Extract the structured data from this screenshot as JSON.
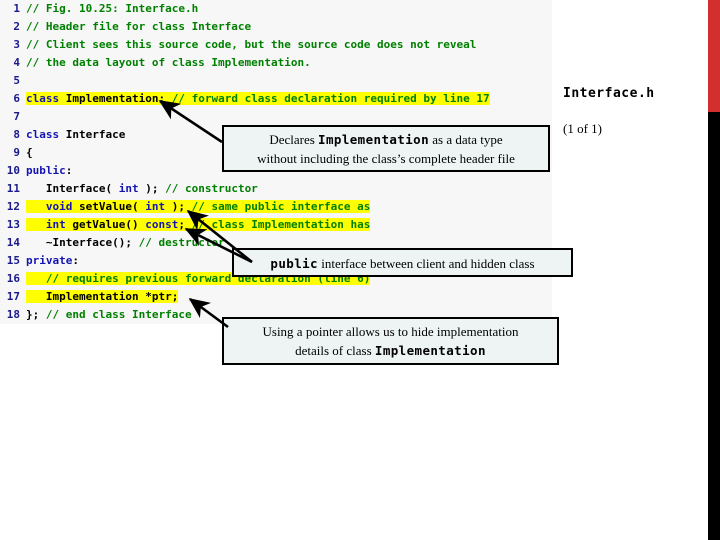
{
  "slide": {
    "file_title": "Interface.h",
    "page_indicator": "(1 of 1)",
    "accent_color": "#d32f2f",
    "highlight_color": "#ffff00",
    "comment_color": "#008000",
    "keyword_color": "#1414b4",
    "callout_fill": "#eef4f4",
    "code_panel_fill": "#f7f7f7"
  },
  "code": {
    "lines": [
      {
        "n": "1",
        "highlight": false,
        "tokens": [
          {
            "t": "c",
            "s": "// Fig. 10.25: Interface.h"
          }
        ]
      },
      {
        "n": "2",
        "highlight": false,
        "tokens": [
          {
            "t": "c",
            "s": "// Header file for class Interface"
          }
        ]
      },
      {
        "n": "3",
        "highlight": false,
        "tokens": [
          {
            "t": "c",
            "s": "// Client sees this source code, but the source code does not reveal"
          }
        ]
      },
      {
        "n": "4",
        "highlight": false,
        "tokens": [
          {
            "t": "c",
            "s": "// the data layout of class Implementation."
          }
        ]
      },
      {
        "n": "5",
        "highlight": false,
        "tokens": [
          {
            "t": "p",
            "s": ""
          }
        ]
      },
      {
        "n": "6",
        "highlight": true,
        "tokens": [
          {
            "t": "k",
            "s": "class"
          },
          {
            "t": "p",
            "s": " Implementation; "
          },
          {
            "t": "c",
            "s": "// forward class declaration required by line 17"
          }
        ]
      },
      {
        "n": "7",
        "highlight": false,
        "tokens": [
          {
            "t": "p",
            "s": ""
          }
        ]
      },
      {
        "n": "8",
        "highlight": false,
        "tokens": [
          {
            "t": "k",
            "s": "class"
          },
          {
            "t": "p",
            "s": " Interface"
          }
        ]
      },
      {
        "n": "9",
        "highlight": false,
        "tokens": [
          {
            "t": "p",
            "s": "{"
          }
        ]
      },
      {
        "n": "10",
        "highlight": false,
        "tokens": [
          {
            "t": "k",
            "s": "public"
          },
          {
            "t": "p",
            "s": ":"
          }
        ]
      },
      {
        "n": "11",
        "highlight": false,
        "tokens": [
          {
            "t": "p",
            "s": "   Interface( "
          },
          {
            "t": "k",
            "s": "int"
          },
          {
            "t": "p",
            "s": " ); "
          },
          {
            "t": "c",
            "s": "// constructor"
          }
        ]
      },
      {
        "n": "12",
        "highlight": true,
        "tokens": [
          {
            "t": "p",
            "s": "   "
          },
          {
            "t": "k",
            "s": "void"
          },
          {
            "t": "p",
            "s": " setValue( "
          },
          {
            "t": "k",
            "s": "int"
          },
          {
            "t": "p",
            "s": " ); "
          },
          {
            "t": "c",
            "s": "// same public interface as"
          }
        ]
      },
      {
        "n": "13",
        "highlight": true,
        "tokens": [
          {
            "t": "p",
            "s": "   "
          },
          {
            "t": "k",
            "s": "int"
          },
          {
            "t": "p",
            "s": " getValue() "
          },
          {
            "t": "k",
            "s": "const"
          },
          {
            "t": "p",
            "s": "; "
          },
          {
            "t": "c",
            "s": "// class Implementation has"
          }
        ]
      },
      {
        "n": "14",
        "highlight": false,
        "tokens": [
          {
            "t": "p",
            "s": "   ~Interface(); "
          },
          {
            "t": "c",
            "s": "// destructor"
          }
        ]
      },
      {
        "n": "15",
        "highlight": false,
        "tokens": [
          {
            "t": "k",
            "s": "private"
          },
          {
            "t": "p",
            "s": ":"
          }
        ]
      },
      {
        "n": "16",
        "highlight": true,
        "tokens": [
          {
            "t": "p",
            "s": "   "
          },
          {
            "t": "c",
            "s": "// requires previous forward declaration (line 6)"
          }
        ]
      },
      {
        "n": "17",
        "highlight": true,
        "tokens": [
          {
            "t": "p",
            "s": "   Implementation *ptr;"
          }
        ]
      },
      {
        "n": "18",
        "highlight": false,
        "tokens": [
          {
            "t": "p",
            "s": "}; "
          },
          {
            "t": "c",
            "s": "// end class Interface"
          }
        ]
      }
    ]
  },
  "callouts": {
    "declares": {
      "line1_pre": "Declares ",
      "line1_mono": "Implementation",
      "line1_post": " as a data type",
      "line2": "without including the class’s complete header file"
    },
    "public_interface": {
      "mono": "public",
      "text": " interface between client and hidden class"
    },
    "pointer": {
      "line1": "Using a pointer allows us to hide implementation",
      "line2_pre": "details of class ",
      "line2_mono": "Implementation"
    }
  }
}
